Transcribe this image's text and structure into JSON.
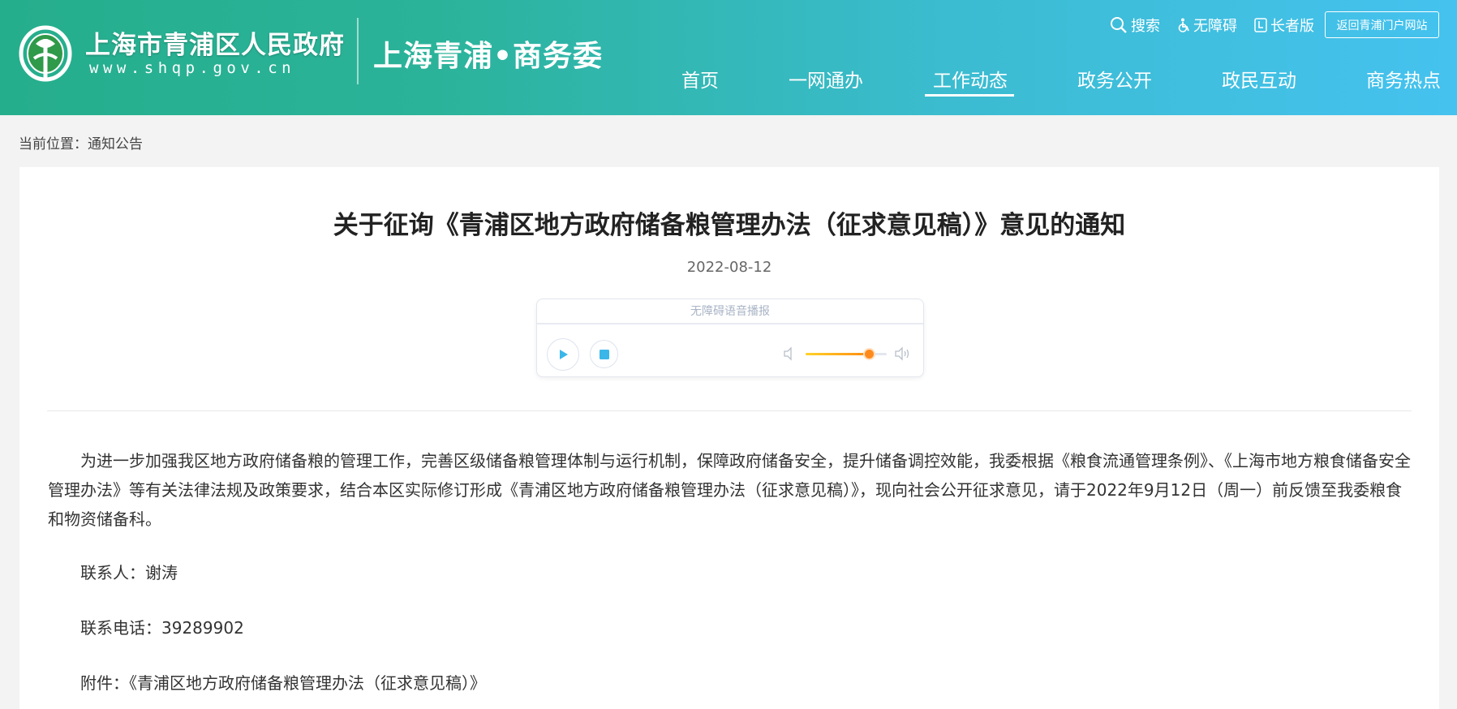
{
  "header": {
    "logo_title": "上海市青浦区人民政府",
    "logo_url": "www.shqp.gov.cn",
    "site_name": "上海青浦•商务委",
    "utilities": {
      "search": "搜索",
      "accessibility": "无障碍",
      "elder": "长者版",
      "portal": "返回青浦门户网站"
    },
    "nav": [
      "首页",
      "一网通办",
      "工作动态",
      "政务公开",
      "政民互动",
      "商务热点"
    ],
    "active_nav": "工作动态"
  },
  "breadcrumb": "当前位置：通知公告",
  "article": {
    "title": "关于征询《青浦区地方政府储备粮管理办法（征求意见稿）》意见的通知",
    "date": "2022-08-12",
    "player": {
      "label": "无障碍语音播报",
      "volume": 0.78
    },
    "body": "为进一步加强我区地方政府储备粮的管理工作，完善区级储备粮管理体制与运行机制，保障政府储备安全，提升储备调控效能，我委根据《粮食流通管理条例》、《上海市地方粮食储备安全管理办法》等有关法律法规及政策要求，结合本区实际修订形成《青浦区地方政府储备粮管理办法（征求意见稿）》，现向社会公开征求意见，请于2022年9月12日（周一）前反馈至我委粮食和物资储备科。",
    "contact": "联系人：谢涛",
    "phone": "联系电话：39289902",
    "attachment": "附件：《青浦区地方政府储备粮管理办法（征求意见稿）》"
  },
  "colors": {
    "header_start": "#25ae8c",
    "header_end": "#45c2ef",
    "play_accent": "#3ab6e8",
    "volume_accent": "#ff8a1c"
  }
}
